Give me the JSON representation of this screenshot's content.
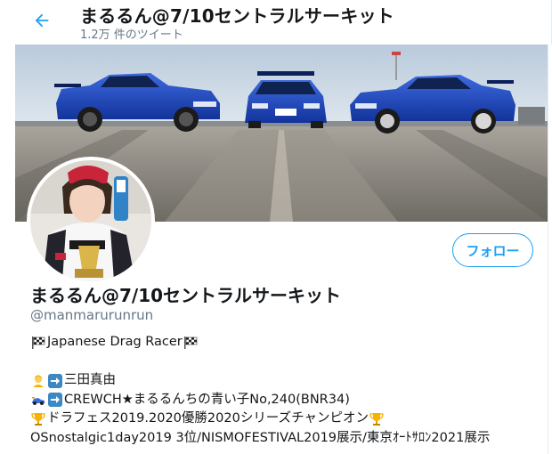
{
  "header": {
    "title": "まるるん@7/10セントラルサーキット",
    "subtitle": "1.2万 件のツイート"
  },
  "profile": {
    "name": "まるるん@7/10セントラルサーキット",
    "handle": "@manmarurunrun",
    "follow_label": "フォロー"
  },
  "bio": {
    "line1": "Japanese Drag Racer",
    "line2": "三田真由",
    "line3": "CREWCH★まるるんちの青い子No,240(BNR34)",
    "line4": "ドラフェス2019.2020優勝2020シリーズチャンピオン",
    "line5": "OSnostalgic1day2019 3位/NISMOFESTIVAL2019展示/東京ｵｰﾄｻﾛﾝ2021展示"
  },
  "icons": [
    "back-arrow-icon",
    "checkered-flag-icon",
    "person-icon",
    "right-arrow-icon",
    "race-car-icon",
    "trophy-icon"
  ],
  "colors": {
    "accent": "#1da1f2",
    "text": "#14171a",
    "secondary": "#657786",
    "car_blue": "#1a48c8"
  }
}
